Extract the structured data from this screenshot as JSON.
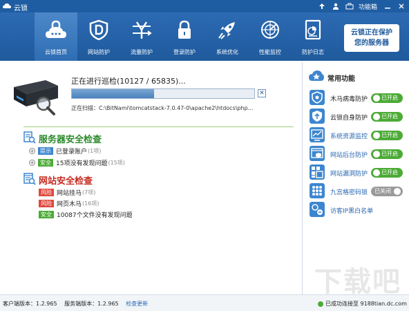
{
  "window": {
    "title": "云锁"
  },
  "titlebar": {
    "menu_label": "功能箱"
  },
  "nav": [
    {
      "label": "云锁首页",
      "icon": "lock-cloud-icon",
      "active": true
    },
    {
      "label": "网站防护",
      "icon": "shield-d-icon"
    },
    {
      "label": "流量防护",
      "icon": "traffic-icon"
    },
    {
      "label": "登录防护",
      "icon": "padlock-icon"
    },
    {
      "label": "系统优化",
      "icon": "rocket-icon"
    },
    {
      "label": "性能监控",
      "icon": "radar-icon"
    },
    {
      "label": "防护日志",
      "icon": "log-report-icon"
    }
  ],
  "protect_box": {
    "line1": "云锁正在保护",
    "line2": "您的服务器"
  },
  "scan": {
    "title": "正在进行巡检(10127 / 65835)...",
    "progress": 0.45,
    "close": "✕",
    "path_label": "正在扫描：",
    "path": "C:\\BitNami\\tomcatstack-7.0.47-0\\apache2\\htdocs\\php..."
  },
  "server_section": {
    "title": "服务器安全检查",
    "rows": [
      {
        "badge": "提示",
        "text": "已登录账户",
        "count": "(1项)",
        "expand": "+"
      },
      {
        "badge": "安全",
        "text": "15项没有发现问题",
        "count": "(15项)",
        "expand": "+"
      }
    ]
  },
  "web_section": {
    "title": "网站安全检查",
    "rows": [
      {
        "badge": "风险",
        "text": "网站挂马",
        "count": "(7项)"
      },
      {
        "badge": "风险",
        "text": "网页木马",
        "count": "(16项)"
      },
      {
        "badge": "安全",
        "text": "10087个文件没有发现问题",
        "count": ""
      }
    ]
  },
  "right_panel": {
    "title": "常用功能",
    "features": [
      {
        "label": "木马病毒防护",
        "toggle": "已开启",
        "on": true,
        "icon": "trojan-shield-icon"
      },
      {
        "label": "云锁自身防护",
        "toggle": "已开启",
        "on": true,
        "icon": "self-protect-icon"
      },
      {
        "label": "系统资源监控",
        "toggle": "已开启",
        "on": true,
        "icon": "resource-monitor-icon",
        "link": true
      },
      {
        "label": "网站后台防护",
        "toggle": "已开启",
        "on": true,
        "icon": "admin-protect-icon",
        "link": true
      },
      {
        "label": "网站漏洞防护",
        "toggle": "已开启",
        "on": true,
        "icon": "vuln-protect-icon",
        "link": true
      },
      {
        "label": "九宫格密码锁",
        "toggle": "已关闭",
        "on": false,
        "icon": "grid-lock-icon",
        "link": true
      },
      {
        "label": "访客IP黑白名单",
        "icon": "ip-list-icon",
        "link": true
      }
    ]
  },
  "footer": {
    "client_version": "客户端版本：1.2.965",
    "service_version": "服务端版本：1.2.965",
    "check_update": "检查更新",
    "status": "已成功连接至 9188tian.dc.com"
  },
  "colors": {
    "brand": "#1f5da3",
    "safe": "#4cab36",
    "risk": "#e0483d",
    "tip": "#3d86cf"
  }
}
